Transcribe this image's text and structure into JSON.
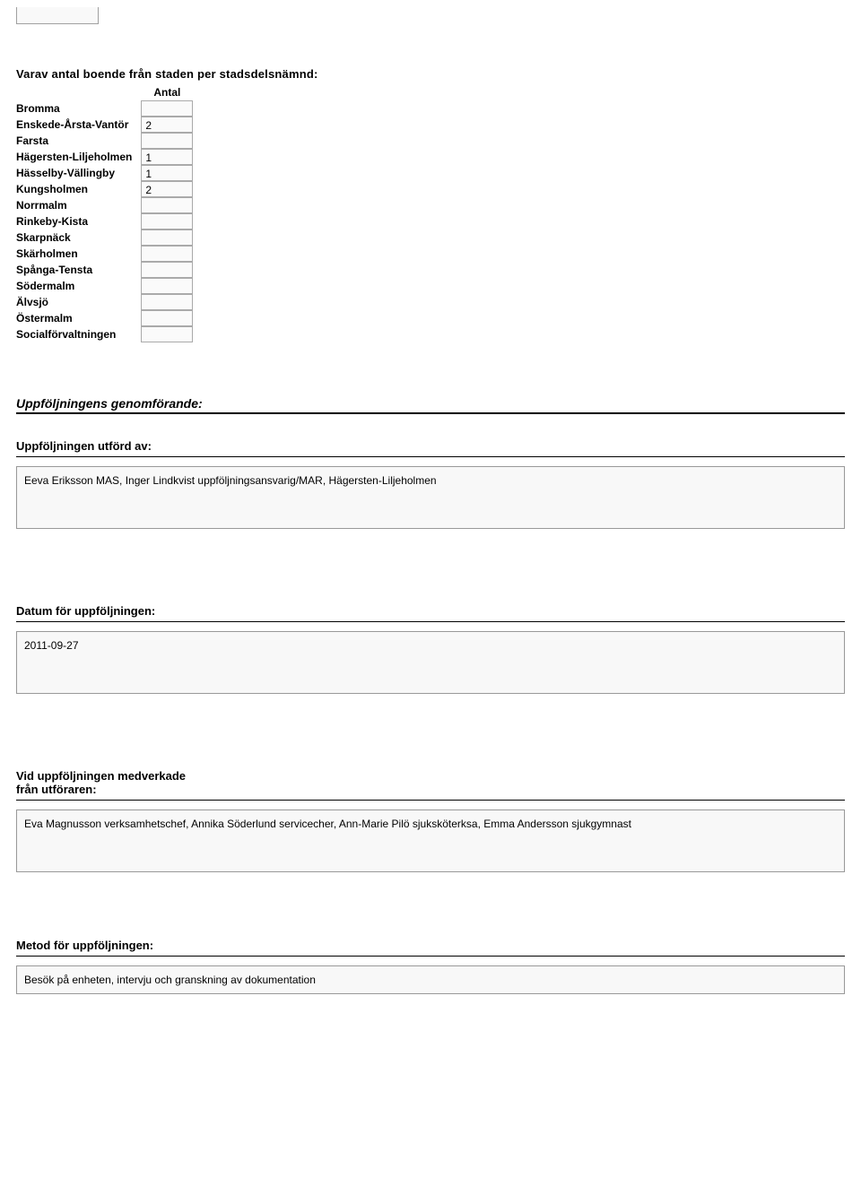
{
  "header": {
    "title": "Varav antal boende från staden per stadsdelsnämnd:",
    "column_header": "Antal"
  },
  "districts": [
    {
      "name": "Bromma",
      "value": ""
    },
    {
      "name": "Enskede-Årsta-Vantör",
      "value": "2"
    },
    {
      "name": "Farsta",
      "value": ""
    },
    {
      "name": "Hägersten-Liljeholmen",
      "value": "1"
    },
    {
      "name": "Hässelby-Vällingby",
      "value": "1"
    },
    {
      "name": "Kungsholmen",
      "value": "2"
    },
    {
      "name": "Norrmalm",
      "value": ""
    },
    {
      "name": "Rinkeby-Kista",
      "value": ""
    },
    {
      "name": "Skarpnäck",
      "value": ""
    },
    {
      "name": "Skärholmen",
      "value": ""
    },
    {
      "name": "Spånga-Tensta",
      "value": ""
    },
    {
      "name": "Södermalm",
      "value": ""
    },
    {
      "name": "Älvsjö",
      "value": ""
    },
    {
      "name": "Östermalm",
      "value": ""
    },
    {
      "name": "Socialförvaltningen",
      "value": ""
    }
  ],
  "section": {
    "title": "Uppföljningens genomförande:"
  },
  "utford_av": {
    "label": "Uppföljningen utförd av:",
    "value": "Eeva Eriksson MAS, Inger Lindkvist uppföljningsansvarig/MAR, Hägersten-Liljeholmen"
  },
  "datum": {
    "label": "Datum för uppföljningen:",
    "value": "2011-09-27"
  },
  "medverkade": {
    "label_line1": "Vid uppföljningen medverkade",
    "label_line2": "från utföraren:",
    "value": "Eva Magnusson verksamhetschef, Annika Söderlund servicecher, Ann-Marie Pilö sjuksköterksa, Emma Andersson sjukgymnast"
  },
  "metod": {
    "label": "Metod för uppföljningen:",
    "value": "Besök på enheten, intervju och granskning av dokumentation"
  }
}
